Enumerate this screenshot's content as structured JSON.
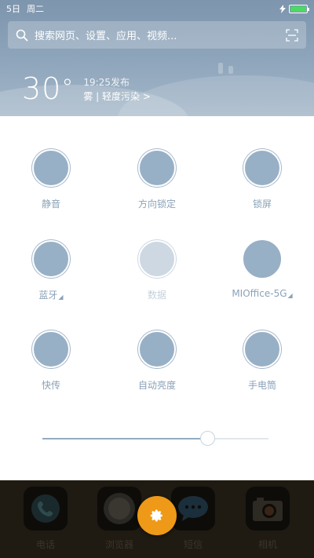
{
  "status_bar": {
    "date": "5日",
    "weekday": "周二",
    "battery_color": "#4cd964"
  },
  "search": {
    "placeholder": "搜索网页、设置、应用、视频..."
  },
  "weather": {
    "temperature": "30",
    "degree_symbol": "°",
    "publish_time": "19:25发布",
    "condition": "雾 | 轻度污染 >"
  },
  "toggles": [
    {
      "label": "静音",
      "icon": "silent-icon",
      "state": "on"
    },
    {
      "label": "方向锁定",
      "icon": "rotation-lock-icon",
      "state": "on"
    },
    {
      "label": "锁屏",
      "icon": "lock-screen-icon",
      "state": "on"
    },
    {
      "label": "蓝牙",
      "icon": "bluetooth-icon",
      "state": "on",
      "expandable": true
    },
    {
      "label": "数据",
      "icon": "mobile-data-icon",
      "state": "disabled"
    },
    {
      "label": "MIOffice-5G",
      "icon": "wifi-icon",
      "state": "on",
      "expandable": true
    },
    {
      "label": "快传",
      "icon": "quick-share-icon",
      "state": "on"
    },
    {
      "label": "自动亮度",
      "icon": "auto-brightness-icon",
      "state": "on"
    },
    {
      "label": "手电筒",
      "icon": "flashlight-icon",
      "state": "on"
    }
  ],
  "brightness": {
    "level_fraction": 0.73
  },
  "dock": {
    "apps": [
      {
        "label": "电话",
        "icon": "phone-icon"
      },
      {
        "label": "浏览器",
        "icon": "browser-icon"
      },
      {
        "label": "短信",
        "icon": "messages-icon"
      },
      {
        "label": "相机",
        "icon": "camera-icon"
      }
    ]
  },
  "settings_button": {
    "icon": "gear-icon",
    "color": "#ee9918"
  },
  "colors": {
    "toggle_active": "#98b0c6",
    "toggle_disabled": "#cdd8e2",
    "label": "#8aa2b8"
  }
}
